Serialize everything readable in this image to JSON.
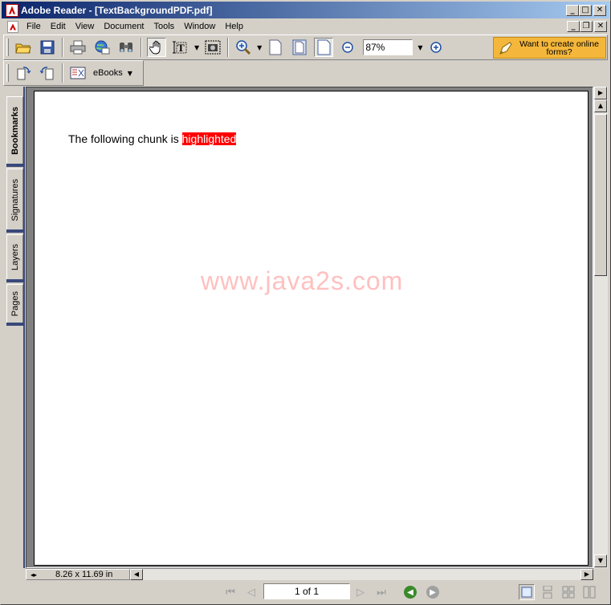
{
  "window": {
    "title": "Adobe Reader - [TextBackgroundPDF.pdf]",
    "minimize": "_",
    "maximize": "□",
    "close": "✕"
  },
  "menu": [
    "File",
    "Edit",
    "View",
    "Document",
    "Tools",
    "Window",
    "Help"
  ],
  "toolbar": {
    "zoom_value": "87%",
    "promo_text": "Want to create online forms?",
    "ebooks_label": "eBooks"
  },
  "nav_tabs": [
    "Bookmarks",
    "Signatures",
    "Layers",
    "Pages"
  ],
  "document": {
    "text_before": "The following chunk is ",
    "highlighted_text": "highlighted",
    "highlight_color": "#ff0000",
    "watermark": "www.java2s.com",
    "watermark_color": "#ffc0c0"
  },
  "status": {
    "page_size": "8.26 x 11.69 in",
    "page_indicator": "1 of 1"
  },
  "colors": {
    "titlebar_start": "#0a246a",
    "titlebar_end": "#a6caf0",
    "promo_bg": "#f4b73b",
    "chrome": "#d4d0c8"
  }
}
